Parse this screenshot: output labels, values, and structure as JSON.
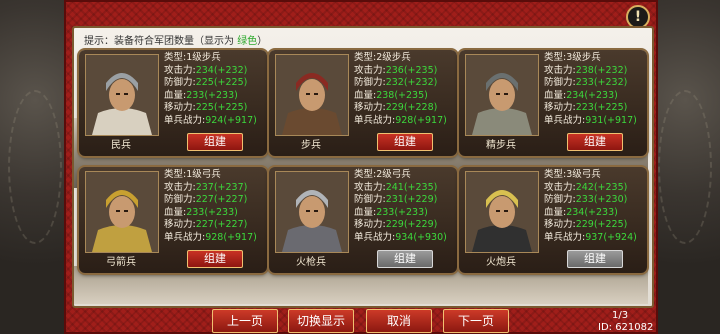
{
  "hint": {
    "prefix": "提示：装备符合军团数量（显示为 ",
    "highlight": "绿色",
    "suffix": "）"
  },
  "labels": {
    "type": "类型:",
    "attack": "攻击力:",
    "defense": "防御力:",
    "hp": "血量:",
    "move": "移动力:",
    "power": "单兵战力:"
  },
  "units": [
    {
      "name": "民兵",
      "type": "1级步兵",
      "attack": "234(+232)",
      "defense": "225(+225)",
      "hp": "233(+233)",
      "move": "225(+225)",
      "power": "924(+917)",
      "button": "组建",
      "enabled": true
    },
    {
      "name": "步兵",
      "type": "2级步兵",
      "attack": "236(+235)",
      "defense": "232(+232)",
      "hp": "238(+235)",
      "move": "229(+228)",
      "power": "928(+917)",
      "button": "组建",
      "enabled": true
    },
    {
      "name": "精步兵",
      "type": "3级步兵",
      "attack": "238(+232)",
      "defense": "233(+232)",
      "hp": "234(+233)",
      "move": "223(+225)",
      "power": "931(+917)",
      "button": "组建",
      "enabled": true
    },
    {
      "name": "弓箭兵",
      "type": "1级弓兵",
      "attack": "237(+237)",
      "defense": "227(+227)",
      "hp": "233(+233)",
      "move": "227(+227)",
      "power": "928(+917)",
      "button": "组建",
      "enabled": true
    },
    {
      "name": "火枪兵",
      "type": "2级弓兵",
      "attack": "241(+235)",
      "defense": "231(+229)",
      "hp": "233(+233)",
      "move": "229(+229)",
      "power": "934(+930)",
      "button": "组建",
      "enabled": false
    },
    {
      "name": "火炮兵",
      "type": "3级弓兵",
      "attack": "242(+235)",
      "defense": "233(+230)",
      "hp": "234(+233)",
      "move": "229(+225)",
      "power": "937(+924)",
      "button": "组建",
      "enabled": false
    }
  ],
  "footer": {
    "prev": "上一页",
    "toggle": "切换显示",
    "cancel": "取消",
    "next": "下一页",
    "page": "1/3",
    "id": "ID: 621082"
  }
}
